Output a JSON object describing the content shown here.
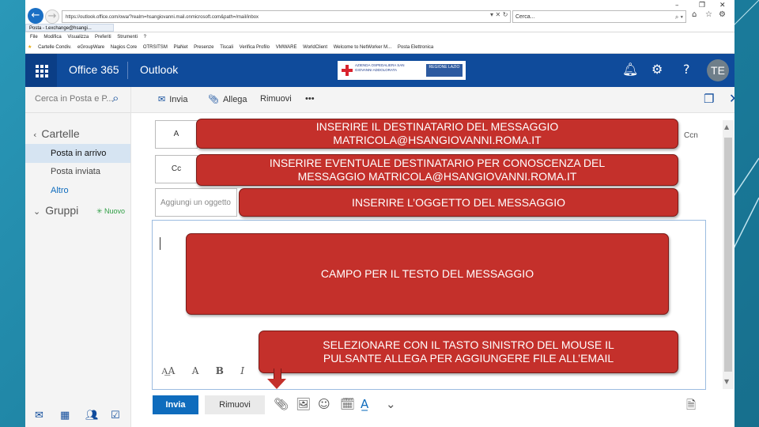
{
  "browser": {
    "url": "https://outlook.office.com/owa/?realm=hsangiovanni.mail.onmicrosoft.com&path=/mail/inbox",
    "search_placeholder": "Cerca...",
    "tab_title": "Posta - t.exchange@hsangi...",
    "menu": [
      "File",
      "Modifica",
      "Visualizza",
      "Preferiti",
      "Strumenti",
      "?"
    ],
    "favorites": [
      "Cartelle Condiv.",
      "eGroupWare",
      "Nagios Core",
      "OTRSITSM",
      "PlaNet",
      "Presenze",
      "Tiscali",
      "Verifica Profilo",
      "VMWARE",
      "WorldClient",
      "Welcome to NetWorker M...",
      "Posta Elettronica"
    ]
  },
  "suite": {
    "product": "Office 365",
    "app": "Outlook",
    "logo_text": "AZIENDA OSPEDALIERA SAN GIOVANNI ADDOLORATA",
    "logo_region": "REGIONE LAZIO",
    "avatar_initials": "TE"
  },
  "nav": {
    "search_placeholder": "Cerca in Posta e P...",
    "folders_header": "Cartelle",
    "items": [
      "Posta in arrivo",
      "Posta inviata",
      "Altro"
    ],
    "groups_header": "Gruppi",
    "new_label": "Nuovo"
  },
  "compose": {
    "send": "Invia",
    "attach": "Allega",
    "discard": "Rimuovi",
    "more": "•••",
    "to_label": "A",
    "cc_label": "Cc",
    "bcc_label": "Ccn",
    "subject_placeholder": "Aggiungi un oggetto",
    "send_bottom": "Invia",
    "discard_bottom": "Rimuovi"
  },
  "callouts": {
    "to": [
      "INSERIRE IL DESTINATARIO DEL MESSAGGIO",
      "MATRICOLA@HSANGIOVANNI.ROMA.IT"
    ],
    "cc": [
      "INSERIRE EVENTUALE DESTINATARIO PER CONOSCENZA DEL",
      "MESSAGGIO MATRICOLA@HSANGIOVANNI.ROMA.IT"
    ],
    "subject": "INSERIRE L’OGGETTO DEL MESSAGGIO",
    "body": "CAMPO PER IL TESTO DEL MESSAGGIO",
    "attach": [
      "SELEZIONARE CON IL TASTO SINISTRO DEL MOUSE IL",
      "PULSANTE ALLEGA PER AGGIUNGERE FILE ALL’EMAIL"
    ]
  },
  "colors": {
    "suite_bar": "#0f4b9b",
    "callout": "#c4302b",
    "send_button": "#0f6cbd",
    "slide_bg": "#1f87a8"
  }
}
